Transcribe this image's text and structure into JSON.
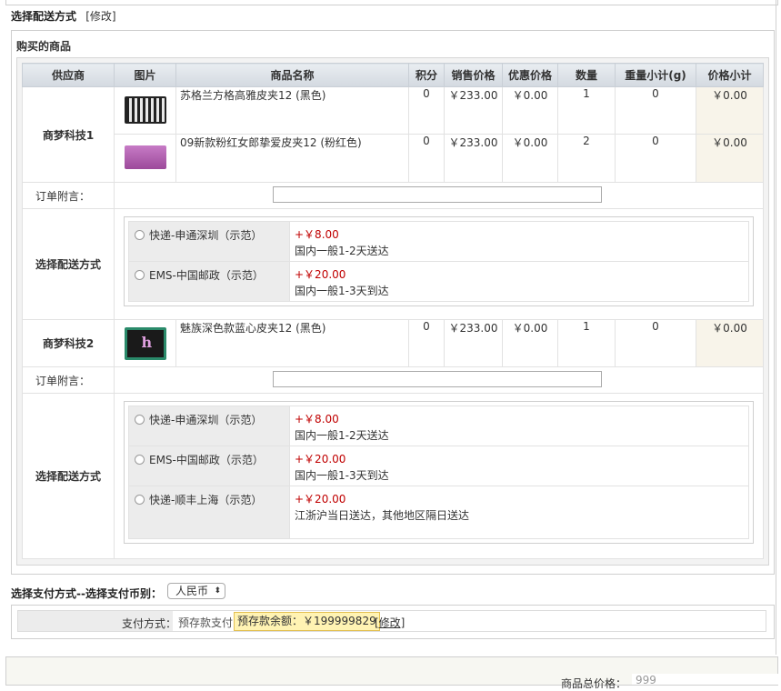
{
  "delivery_header": {
    "title": "选择配送方式",
    "modify": "[修改]"
  },
  "goods_section_title": "购买的商品",
  "columns": [
    "供应商",
    "图片",
    "商品名称",
    "积分",
    "销售价格",
    "优惠价格",
    "数量",
    "重量小计(g)",
    "价格小计"
  ],
  "suppliers": [
    {
      "name": "商梦科技1",
      "products": [
        {
          "image": "plaid-wallet-thumbnail",
          "name": "苏格兰方格高雅皮夹12 (黑色)",
          "points": "0",
          "price": "￥233.00",
          "discount": "￥0.00",
          "qty": "1",
          "weight": "0",
          "subtotal": "￥0.00"
        },
        {
          "image": "pink-wallet-thumbnail",
          "name": "09新款粉红女郎挚爱皮夹12 (粉红色)",
          "points": "0",
          "price": "￥233.00",
          "discount": "￥0.00",
          "qty": "2",
          "weight": "0",
          "subtotal": "￥0.00"
        }
      ],
      "message_label": "订单附言：",
      "message_value": "",
      "shipping_label": "选择配送方式",
      "shipping_options": [
        {
          "name": "快递-申通深圳（示范）",
          "fee": "+￥8.00",
          "desc": "国内一般1-2天送达"
        },
        {
          "name": "EMS-中国邮政（示范）",
          "fee": "+￥20.00",
          "desc": "国内一般1-3天到达"
        }
      ]
    },
    {
      "name": "商梦科技2",
      "products": [
        {
          "image": "dark-wallet-thumbnail",
          "name": "魅族深色款蓝心皮夹12 (黑色)",
          "points": "0",
          "price": "￥233.00",
          "discount": "￥0.00",
          "qty": "1",
          "weight": "0",
          "subtotal": "￥0.00"
        }
      ],
      "message_label": "订单附言：",
      "message_value": "",
      "shipping_label": "选择配送方式",
      "shipping_options": [
        {
          "name": "快递-申通深圳（示范）",
          "fee": "+￥8.00",
          "desc": "国内一般1-2天送达"
        },
        {
          "name": "EMS-中国邮政（示范）",
          "fee": "+￥20.00",
          "desc": "国内一般1-3天到达"
        },
        {
          "name": "快递-顺丰上海（示范）",
          "fee": "+￥20.00",
          "desc": "江浙沪当日送达，其他地区隔日送达"
        }
      ]
    }
  ],
  "payment": {
    "title": "选择支付方式--选择支付币别：",
    "currency": "人民币",
    "method_label": "支付方式：",
    "method": "预存款支付",
    "balance": "预存款余额：￥199999829",
    "modify": "[修改]"
  },
  "summary": {
    "total_label": "商品总价格：",
    "total_value": "999"
  },
  "colors": {
    "price_red": "#c00000",
    "subtotal_bg": "#f8f4ea",
    "balance_bg": "#fff3b3",
    "header_bg": "#d3d9e0"
  }
}
